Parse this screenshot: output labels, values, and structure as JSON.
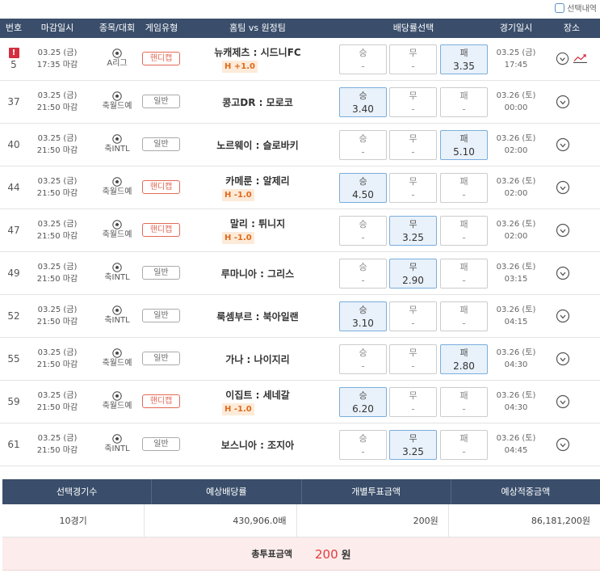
{
  "top": {
    "select_history_label": "선택내역"
  },
  "header": {
    "num": "번호",
    "deadline": "마감일시",
    "league": "종목/대회",
    "game_type": "게임유형",
    "teams": "홈팀 vs 원정팀",
    "odds": "배당률선택",
    "match_date": "경기일시",
    "place": "장소"
  },
  "rows": [
    {
      "num": "5",
      "warn": "!",
      "dl_date": "03.25 (금)",
      "dl_time": "17:35 마감",
      "league": "A리그",
      "type": "핸디캡",
      "handicap": true,
      "teams": "뉴캐제츠 : 시드니FC",
      "hcap": "H +1.0",
      "odds": [
        {
          "label": "승",
          "value": "-",
          "sel": false
        },
        {
          "label": "무",
          "value": "-",
          "sel": false
        },
        {
          "label": "패",
          "value": "3.35",
          "sel": true
        }
      ],
      "m_date": "03.25 (금)",
      "m_time": "17:45",
      "trend": true
    },
    {
      "num": "37",
      "dl_date": "03.25 (금)",
      "dl_time": "21:50 마감",
      "league": "축월드예",
      "type": "일반",
      "handicap": false,
      "teams": "콩고DR : 모로코",
      "hcap": "",
      "odds": [
        {
          "label": "승",
          "value": "3.40",
          "sel": true
        },
        {
          "label": "무",
          "value": "-",
          "sel": false
        },
        {
          "label": "패",
          "value": "-",
          "sel": false
        }
      ],
      "m_date": "03.26 (토)",
      "m_time": "00:00"
    },
    {
      "num": "40",
      "dl_date": "03.25 (금)",
      "dl_time": "21:50 마감",
      "league": "축INTL",
      "type": "일반",
      "handicap": false,
      "teams": "노르웨이 : 슬로바키",
      "hcap": "",
      "odds": [
        {
          "label": "승",
          "value": "-",
          "sel": false
        },
        {
          "label": "무",
          "value": "-",
          "sel": false
        },
        {
          "label": "패",
          "value": "5.10",
          "sel": true
        }
      ],
      "m_date": "03.26 (토)",
      "m_time": "02:00"
    },
    {
      "num": "44",
      "dl_date": "03.25 (금)",
      "dl_time": "21:50 마감",
      "league": "축월드예",
      "type": "핸디캡",
      "handicap": true,
      "teams": "카메룬 : 알제리",
      "hcap": "H -1.0",
      "odds": [
        {
          "label": "승",
          "value": "4.50",
          "sel": true
        },
        {
          "label": "무",
          "value": "-",
          "sel": false
        },
        {
          "label": "패",
          "value": "-",
          "sel": false
        }
      ],
      "m_date": "03.26 (토)",
      "m_time": "02:00"
    },
    {
      "num": "47",
      "dl_date": "03.25 (금)",
      "dl_time": "21:50 마감",
      "league": "축월드예",
      "type": "핸디캡",
      "handicap": true,
      "teams": "말리 : 튀니지",
      "hcap": "H -1.0",
      "odds": [
        {
          "label": "승",
          "value": "-",
          "sel": false
        },
        {
          "label": "무",
          "value": "3.25",
          "sel": true
        },
        {
          "label": "패",
          "value": "-",
          "sel": false
        }
      ],
      "m_date": "03.26 (토)",
      "m_time": "02:00"
    },
    {
      "num": "49",
      "dl_date": "03.25 (금)",
      "dl_time": "21:50 마감",
      "league": "축INTL",
      "type": "일반",
      "handicap": false,
      "teams": "루마니아 : 그리스",
      "hcap": "",
      "odds": [
        {
          "label": "승",
          "value": "-",
          "sel": false
        },
        {
          "label": "무",
          "value": "2.90",
          "sel": true
        },
        {
          "label": "패",
          "value": "-",
          "sel": false
        }
      ],
      "m_date": "03.26 (토)",
      "m_time": "03:15"
    },
    {
      "num": "52",
      "dl_date": "03.25 (금)",
      "dl_time": "21:50 마감",
      "league": "축INTL",
      "type": "일반",
      "handicap": false,
      "teams": "룩셈부르 : 북아일랜",
      "hcap": "",
      "odds": [
        {
          "label": "승",
          "value": "3.10",
          "sel": true
        },
        {
          "label": "무",
          "value": "-",
          "sel": false
        },
        {
          "label": "패",
          "value": "-",
          "sel": false
        }
      ],
      "m_date": "03.26 (토)",
      "m_time": "04:15"
    },
    {
      "num": "55",
      "dl_date": "03.25 (금)",
      "dl_time": "21:50 마감",
      "league": "축월드예",
      "type": "일반",
      "handicap": false,
      "teams": "가나 : 나이지리",
      "hcap": "",
      "odds": [
        {
          "label": "승",
          "value": "-",
          "sel": false
        },
        {
          "label": "무",
          "value": "-",
          "sel": false
        },
        {
          "label": "패",
          "value": "2.80",
          "sel": true
        }
      ],
      "m_date": "03.26 (토)",
      "m_time": "04:30"
    },
    {
      "num": "59",
      "dl_date": "03.25 (금)",
      "dl_time": "21:50 마감",
      "league": "축월드예",
      "type": "핸디캡",
      "handicap": true,
      "teams": "이집트 : 세네갈",
      "hcap": "H -1.0",
      "odds": [
        {
          "label": "승",
          "value": "6.20",
          "sel": true
        },
        {
          "label": "무",
          "value": "-",
          "sel": false
        },
        {
          "label": "패",
          "value": "-",
          "sel": false
        }
      ],
      "m_date": "03.26 (토)",
      "m_time": "04:30"
    },
    {
      "num": "61",
      "dl_date": "03.25 (금)",
      "dl_time": "21:50 마감",
      "league": "축INTL",
      "type": "일반",
      "handicap": false,
      "teams": "보스니아 : 조지아",
      "hcap": "",
      "odds": [
        {
          "label": "승",
          "value": "-",
          "sel": false
        },
        {
          "label": "무",
          "value": "3.25",
          "sel": true
        },
        {
          "label": "패",
          "value": "-",
          "sel": false
        }
      ],
      "m_date": "03.26 (토)",
      "m_time": "04:45"
    }
  ],
  "summary": {
    "headers": [
      "선택경기수",
      "예상배당률",
      "개별투표금액",
      "예상적중금액"
    ],
    "games": "10경기",
    "odds": "430,906.0배",
    "bet": "200원",
    "expected": "86,181,200원",
    "total_label": "총투표금액",
    "total_amount": "200",
    "total_unit": "원"
  },
  "colors": {
    "header_bg": "#3a4e6b",
    "selected_bg": "#e9f1fa",
    "handicap": "#e26a56",
    "total_bg": "#fcecec",
    "total_amount": "#e23b3b"
  },
  "icons": {
    "sport": "soccer-ball-icon",
    "place": "map-pin-icon",
    "trend": "trend-chart-icon",
    "warning": "warning-icon"
  }
}
